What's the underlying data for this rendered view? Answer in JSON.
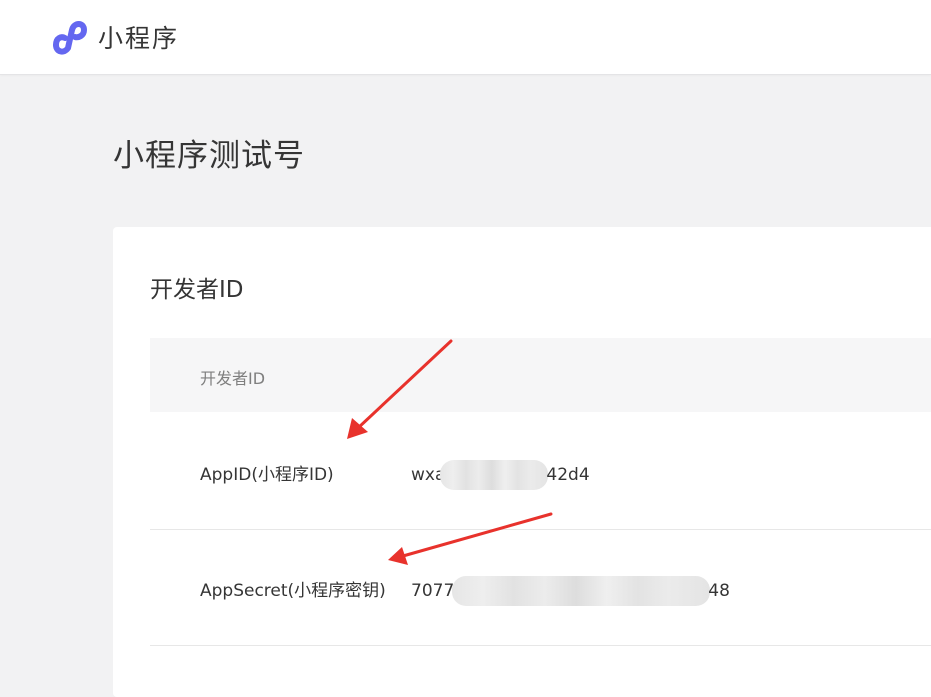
{
  "header": {
    "app_name": "小程序",
    "logo_icon": "miniprogram-logo-icon",
    "brand_color": "#6467f0"
  },
  "page": {
    "title": "小程序测试号"
  },
  "developer_card": {
    "title": "开发者ID",
    "table_header": "开发者ID",
    "rows": [
      {
        "label": "AppID(小程序ID)",
        "value_prefix": "wxa",
        "value_suffix": "42d4"
      },
      {
        "label": "AppSecret(小程序密钥)",
        "value_prefix": "7077",
        "value_suffix": "48"
      }
    ]
  },
  "annotation": {
    "arrow_color": "#e8322c",
    "arrow_icon": "red-arrow-icon"
  }
}
